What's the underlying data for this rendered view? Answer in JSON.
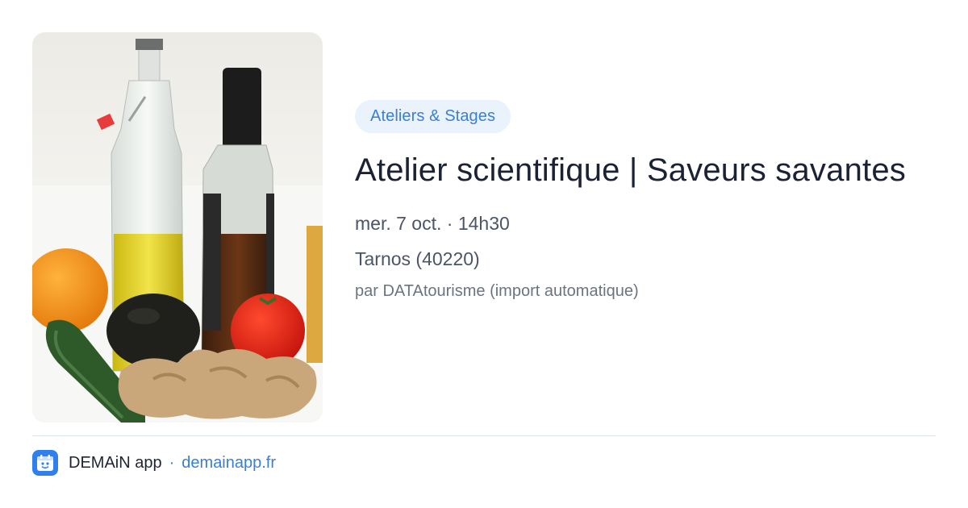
{
  "event": {
    "category": "Ateliers & Stages",
    "title": "Atelier scientifique | Saveurs savantes",
    "date": "mer. 7 oct. · 14h30",
    "location": "Tarnos (40220)",
    "source": "par DATAtourisme (import automatique)"
  },
  "photo": {
    "subject": "Bottles of olive oil and vinegar with orange, cucumber, avocado, ginger and tomato"
  },
  "footer": {
    "app_name": "DEMAiN app",
    "separator": "·",
    "url": "demainapp.fr"
  },
  "colors": {
    "accent": "#3b7fd4",
    "chip_bg": "#eaf2fc",
    "logo_bg": "#2f80ed",
    "title": "#1a2233",
    "muted": "#4b5565"
  }
}
